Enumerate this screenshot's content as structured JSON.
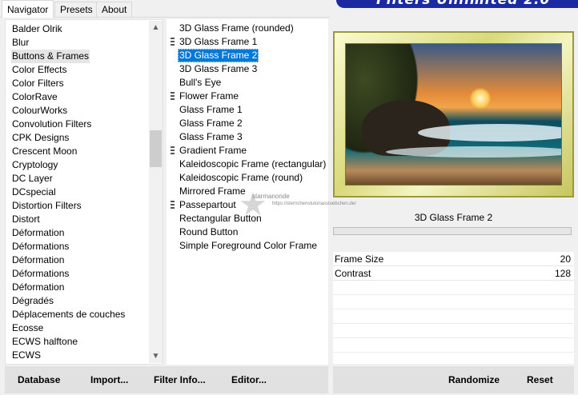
{
  "tabs": [
    {
      "label": "Navigator",
      "active": true
    },
    {
      "label": "Presets",
      "active": false
    },
    {
      "label": "About",
      "active": false
    }
  ],
  "banner": {
    "title": "Filters Unlimited 2.0",
    "color": "#1b2aa0"
  },
  "categories": {
    "selected": "Buttons & Frames",
    "items": [
      "Balder Olrik",
      "Blur",
      "Buttons & Frames",
      "Color Effects",
      "Color Filters",
      "ColorRave",
      "ColourWorks",
      "Convolution Filters",
      "CPK Designs",
      "Crescent Moon",
      "Cryptology",
      "DC Layer",
      "DCspecial",
      "Distortion Filters",
      "Distort",
      "Déformation",
      "Déformations",
      "Déformation",
      "Déformations",
      "Déformation",
      "Dégradés",
      "Déplacements de couches",
      "Ecosse",
      "ECWS halftone",
      "ECWS"
    ]
  },
  "filters": {
    "selected": "3D Glass Frame 2",
    "items": [
      {
        "label": "3D Glass Frame (rounded)",
        "group": false
      },
      {
        "label": "3D Glass Frame 1",
        "group": true
      },
      {
        "label": "3D Glass Frame 2",
        "group": false
      },
      {
        "label": "3D Glass Frame 3",
        "group": false
      },
      {
        "label": "Bull's Eye",
        "group": false
      },
      {
        "label": "Flower Frame",
        "group": true
      },
      {
        "label": "Glass Frame 1",
        "group": false
      },
      {
        "label": "Glass Frame 2",
        "group": false
      },
      {
        "label": "Glass Frame 3",
        "group": false
      },
      {
        "label": "Gradient Frame",
        "group": true
      },
      {
        "label": "Kaleidoscopic Frame (rectangular)",
        "group": false
      },
      {
        "label": "Kaleidoscopic Frame (round)",
        "group": false
      },
      {
        "label": "Mirrored Frame",
        "group": false
      },
      {
        "label": "Passepartout",
        "group": true
      },
      {
        "label": "Rectangular Button",
        "group": false
      },
      {
        "label": "Round Button",
        "group": false
      },
      {
        "label": "Simple Foreground Color Frame",
        "group": false
      }
    ]
  },
  "watermark": {
    "text": "starmanonde",
    "url": "https://sternchenstutoriasstuebchen.de/"
  },
  "preview": {
    "filter_name": "3D Glass Frame 2"
  },
  "params": [
    {
      "label": "Frame Size",
      "value": "20"
    },
    {
      "label": "Contrast",
      "value": "128"
    }
  ],
  "buttons": {
    "database": "Database",
    "import": "Import...",
    "filter_info": "Filter Info...",
    "editor": "Editor...",
    "randomize": "Randomize",
    "reset": "Reset"
  },
  "colors": {
    "selection": "#0078d7",
    "background": "#f0f0f0"
  }
}
